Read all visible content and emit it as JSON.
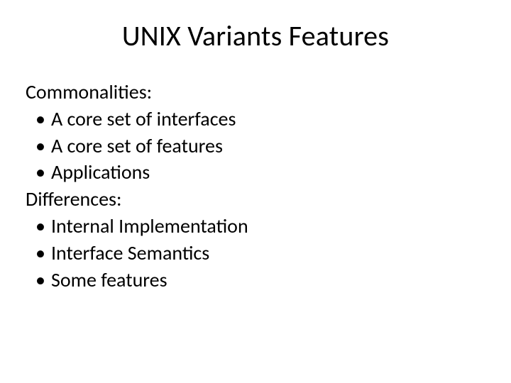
{
  "title": "UNIX Variants Features",
  "sections": [
    {
      "heading": "Commonalities:",
      "items": [
        "A core set of interfaces",
        "A core set of features",
        "Applications"
      ]
    },
    {
      "heading": "Differences:",
      "items": [
        "Internal Implementation",
        "Interface Semantics",
        "Some features"
      ]
    }
  ]
}
